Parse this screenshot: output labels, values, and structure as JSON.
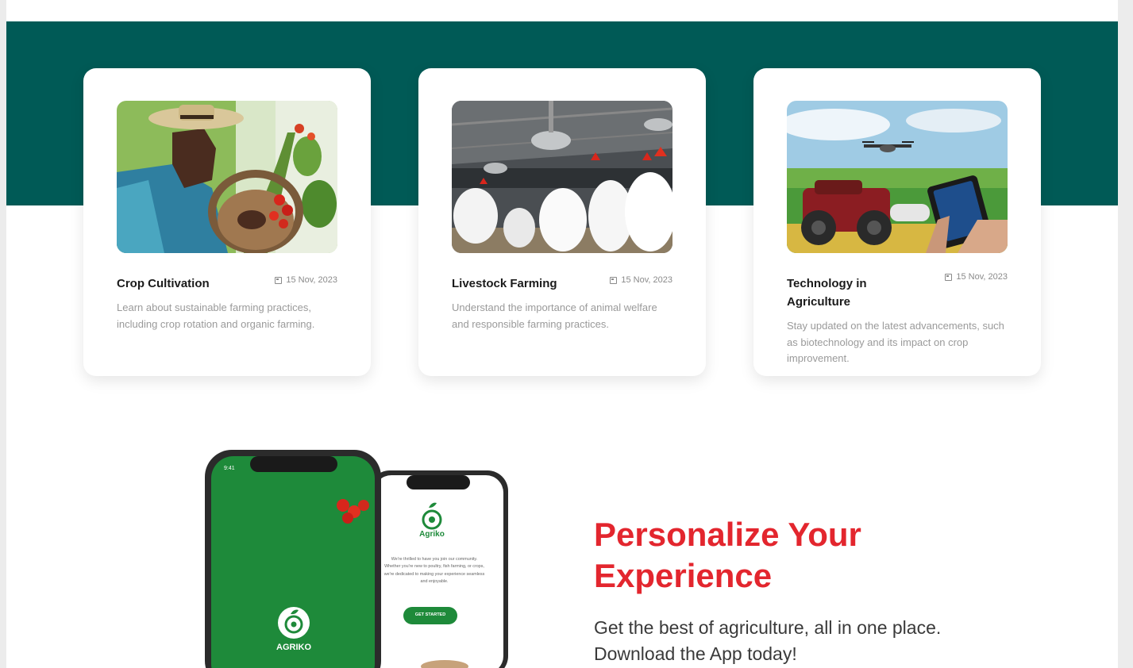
{
  "articles": [
    {
      "title": "Crop Cultivation",
      "date": "15 Nov, 2023",
      "description": "Learn about sustainable farming practices, including crop rotation and organic farming."
    },
    {
      "title": "Livestock Farming",
      "date": "15 Nov, 2023",
      "description": "Understand the importance of animal welfare and responsible farming practices."
    },
    {
      "title": "Technology in Agriculture",
      "date": "15 Nov, 2023",
      "description": "Stay updated on the latest advancements, such as biotechnology and its impact on crop improvement."
    }
  ],
  "promo": {
    "heading": "Personalize Your Experience",
    "subtext": "Get the best of agriculture, all in one place. Download the App today!",
    "phone_front": {
      "time": "9:41",
      "brand": "AGRIKO"
    },
    "phone_back": {
      "brand": "Agriko",
      "welcome_text": "We're thrilled to have you join our community. Whether you're new to poultry, fish farming, or crops, we're dedicated to making your experience seamless and enjoyable.",
      "cta": "GET STARTED"
    }
  },
  "colors": {
    "band": "#005a56",
    "heading": "#e3262e",
    "app_green": "#1e8a3a"
  }
}
